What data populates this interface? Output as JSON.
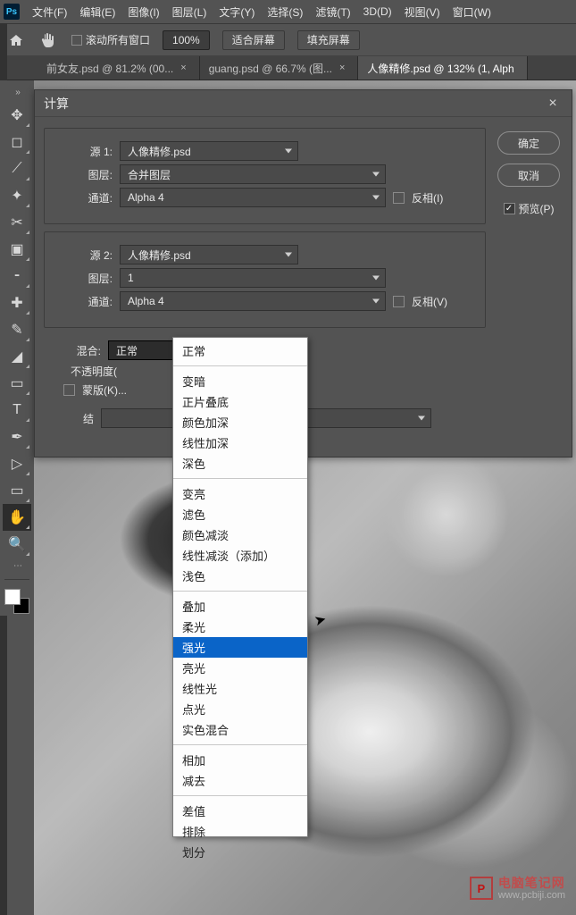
{
  "menu": {
    "items": [
      "文件(F)",
      "编辑(E)",
      "图像(I)",
      "图层(L)",
      "文字(Y)",
      "选择(S)",
      "滤镜(T)",
      "3D(D)",
      "视图(V)",
      "窗口(W)"
    ]
  },
  "options": {
    "scroll_all": "滚动所有窗口",
    "zoom": "100%",
    "fit_screen": "适合屏幕",
    "fill_screen": "填充屏幕"
  },
  "tabs": [
    {
      "label": "前女友.psd @ 81.2% (00...",
      "active": false
    },
    {
      "label": "guang.psd @ 66.7% (图...",
      "active": false
    },
    {
      "label": "人像精修.psd @ 132% (1, Alph",
      "active": true
    }
  ],
  "tools": [
    {
      "name": "move-tool",
      "glyph": "✥"
    },
    {
      "name": "marquee-tool",
      "glyph": "◻"
    },
    {
      "name": "lasso-tool",
      "glyph": "⟋"
    },
    {
      "name": "magic-wand-tool",
      "glyph": "✦"
    },
    {
      "name": "crop-tool",
      "glyph": "✂"
    },
    {
      "name": "frame-tool",
      "glyph": "▣"
    },
    {
      "name": "eyedropper-tool",
      "glyph": "⁃"
    },
    {
      "name": "healing-brush-tool",
      "glyph": "✚"
    },
    {
      "name": "brush-tool",
      "glyph": "✎"
    },
    {
      "name": "eraser-tool",
      "glyph": "◢"
    },
    {
      "name": "gradient-tool",
      "glyph": "▭"
    },
    {
      "name": "type-tool",
      "glyph": "T"
    },
    {
      "name": "pen-tool",
      "glyph": "✒"
    },
    {
      "name": "path-select-tool",
      "glyph": "▷"
    },
    {
      "name": "shape-tool",
      "glyph": "▭"
    },
    {
      "name": "hand-tool",
      "glyph": "✋",
      "selected": true
    },
    {
      "name": "zoom-tool",
      "glyph": "🔍"
    }
  ],
  "dialog": {
    "title": "计算",
    "ok": "确定",
    "cancel": "取消",
    "preview": "预览(P)",
    "source1": {
      "label": "源 1:",
      "file": "人像精修.psd",
      "layer_lbl": "图层:",
      "layer": "合并图层",
      "channel_lbl": "通道:",
      "channel": "Alpha 4",
      "invert": "反相(I)"
    },
    "source2": {
      "label": "源 2:",
      "file": "人像精修.psd",
      "layer_lbl": "图层:",
      "layer": "1",
      "channel_lbl": "通道:",
      "channel": "Alpha 4",
      "invert": "反相(V)"
    },
    "blend": {
      "label": "混合:",
      "value": "正常"
    },
    "opacity": {
      "label": "不透明度("
    },
    "mask": {
      "label": "蒙版(K)..."
    },
    "result": {
      "label": "结"
    }
  },
  "blend_modes": {
    "groups": [
      [
        "正常"
      ],
      [
        "变暗",
        "正片叠底",
        "颜色加深",
        "线性加深",
        "深色"
      ],
      [
        "变亮",
        "滤色",
        "颜色减淡",
        "线性减淡（添加）",
        "浅色"
      ],
      [
        "叠加",
        "柔光",
        "强光",
        "亮光",
        "线性光",
        "点光",
        "实色混合"
      ],
      [
        "相加",
        "减去"
      ],
      [
        "差值",
        "排除",
        "划分"
      ]
    ],
    "highlighted": "强光"
  },
  "watermark": {
    "line1": "电脑笔记网",
    "line2": "www.pcbiji.com",
    "icon": "P"
  }
}
